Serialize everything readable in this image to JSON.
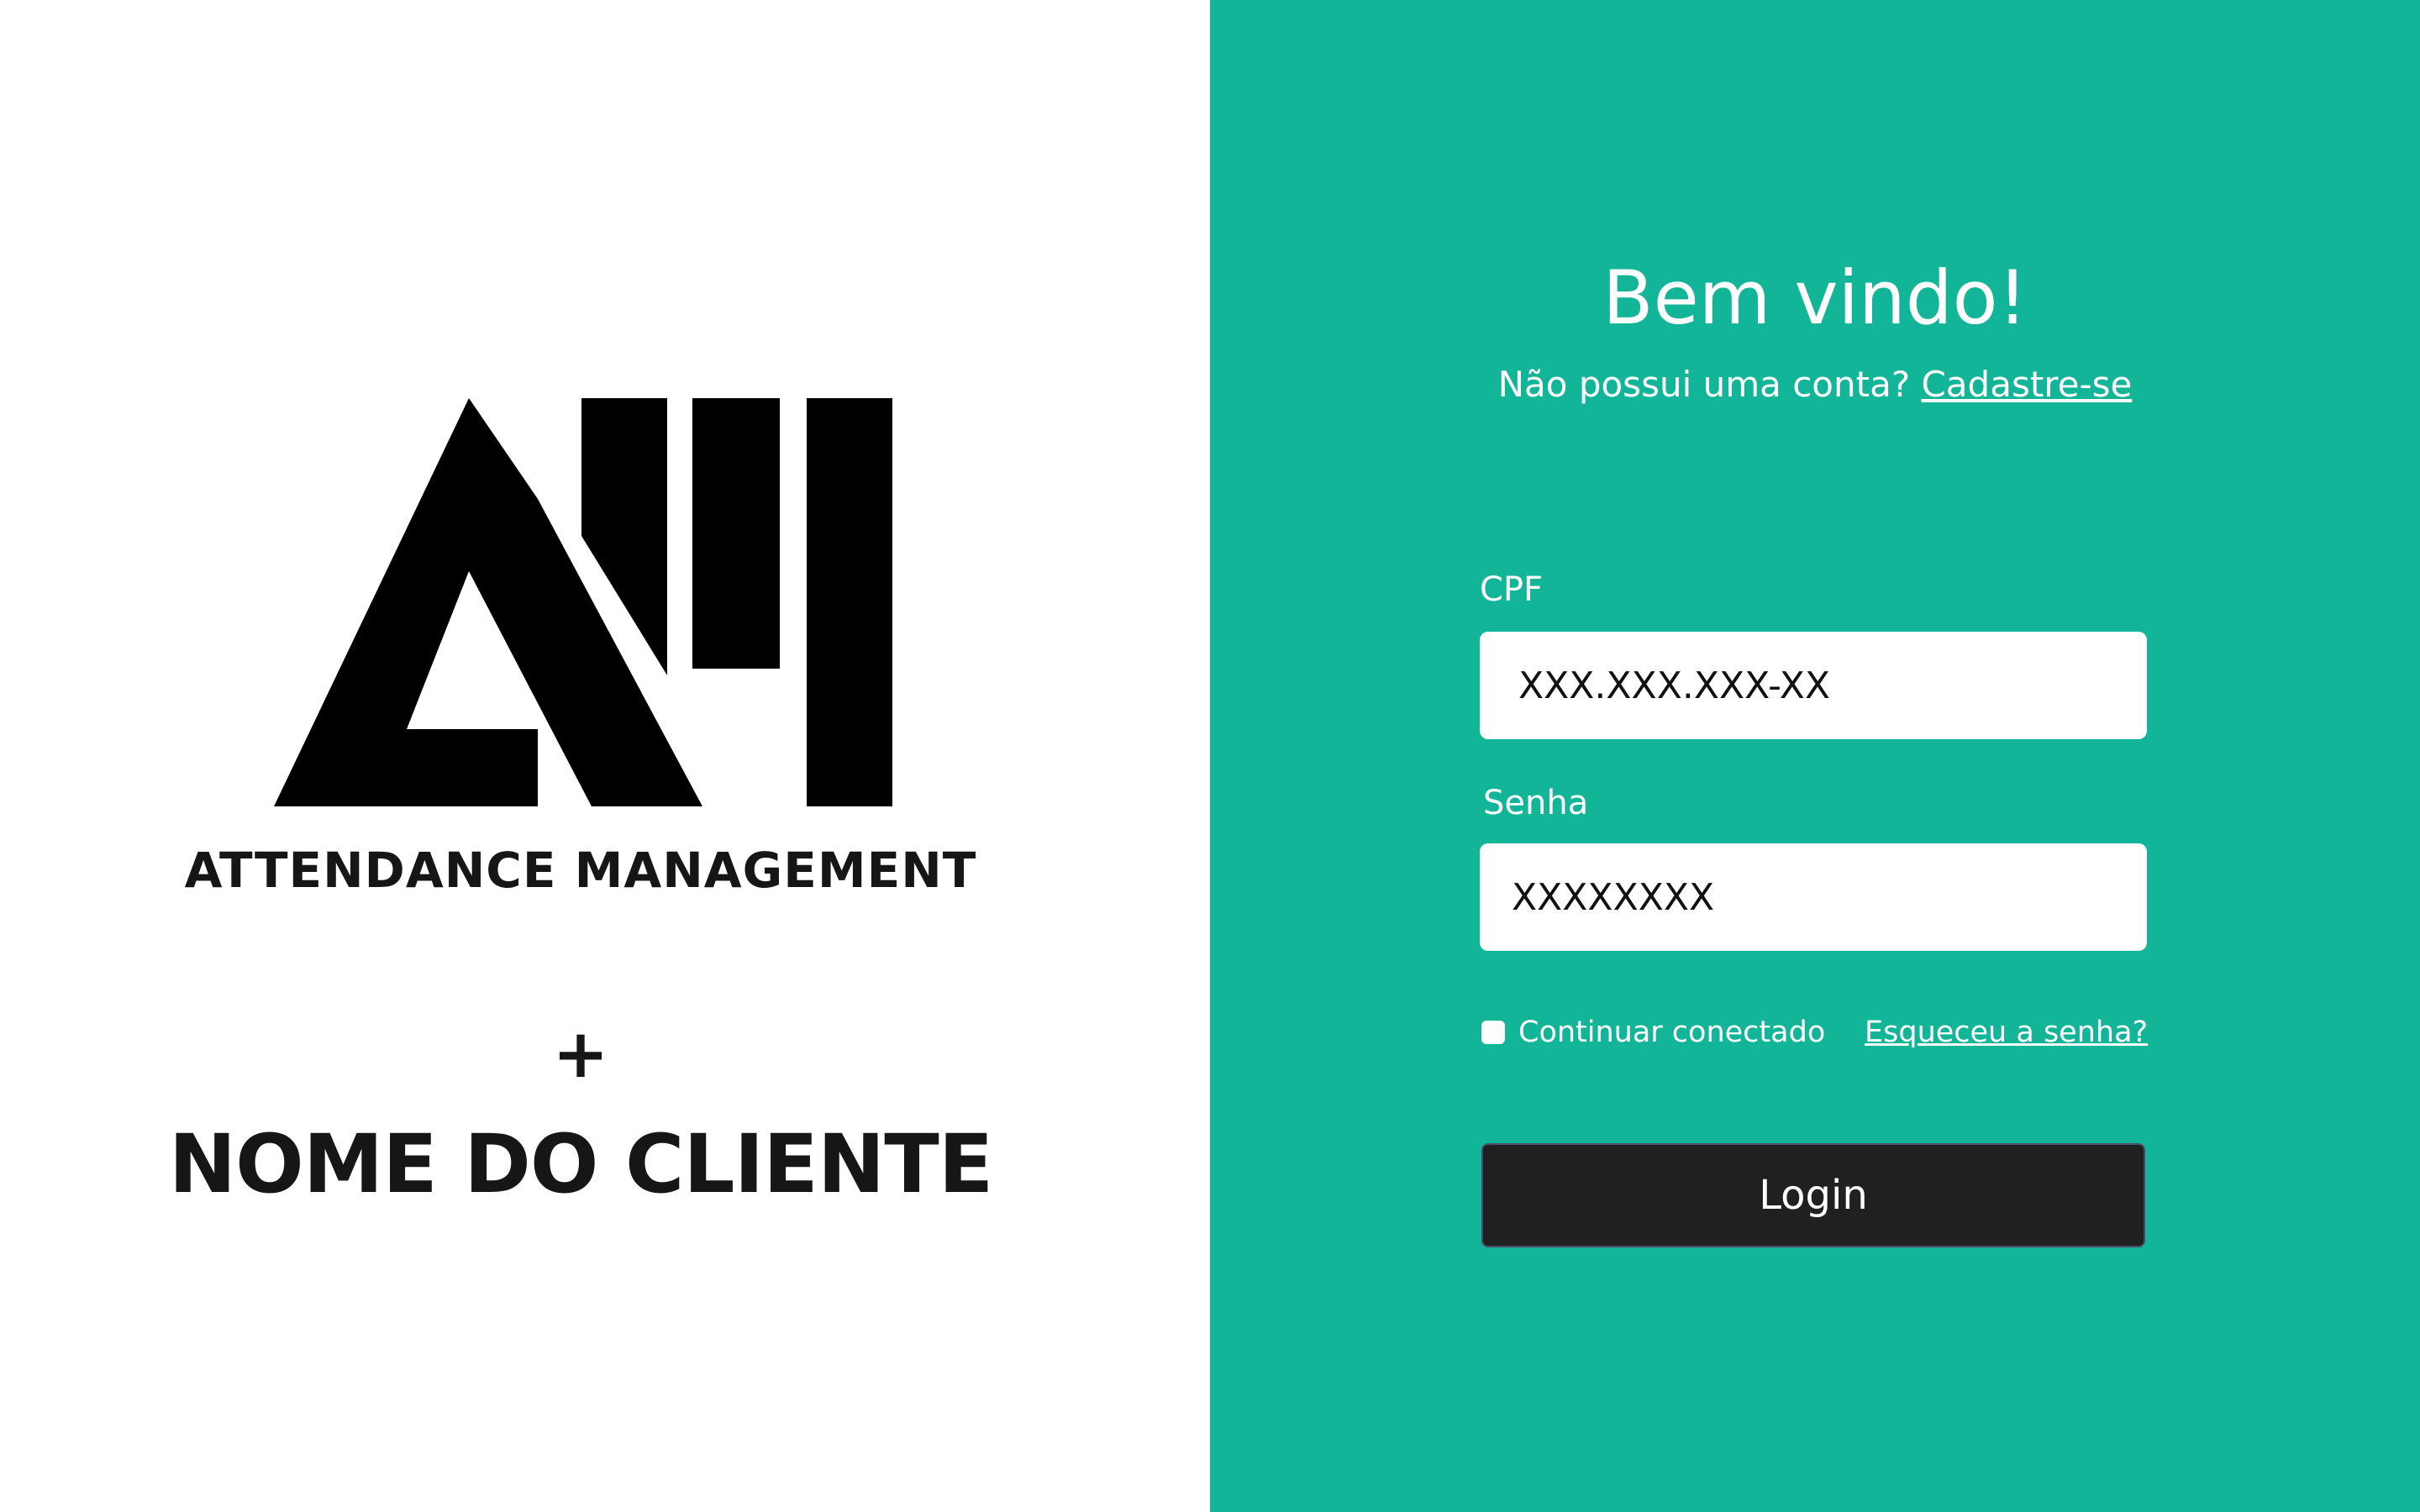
{
  "brand": {
    "logo_icon": "am-logo-icon",
    "tagline": "ATTENDANCE MANAGEMENT",
    "plus": "+",
    "client_name": "NOME DO CLIENTE"
  },
  "login": {
    "title": "Bem vindo!",
    "signup_prompt": "Não possui uma conta?",
    "signup_link": "Cadastre-se",
    "cpf_label": "CPF",
    "cpf_placeholder": "XXX.XXX.XXX-XX",
    "password_label": "Senha",
    "password_placeholder": "XXXXXXXX",
    "remember_label": "Continuar conectado",
    "remember_checked": false,
    "forgot_link": "Esqueceu a senha?",
    "submit_label": "Login"
  },
  "colors": {
    "left_background": "#ffffff",
    "right_background": "#13b598",
    "brand_text": "#161616",
    "button_background": "#202020"
  }
}
